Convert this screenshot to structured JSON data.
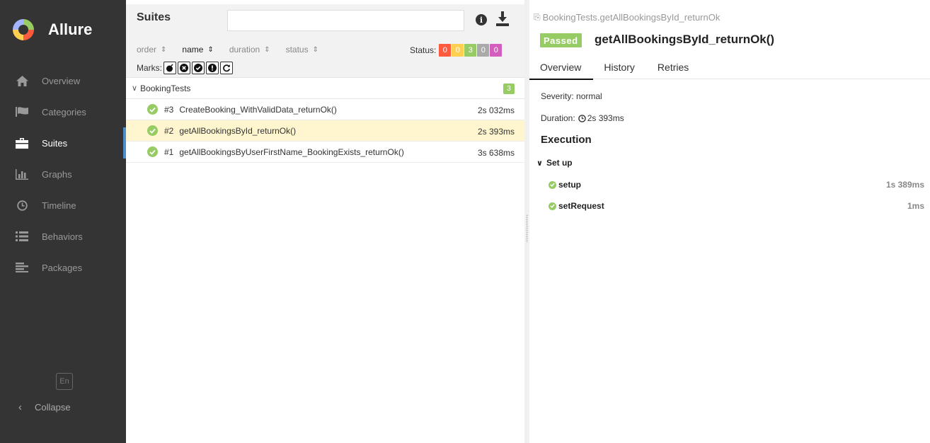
{
  "app": {
    "name": "Allure"
  },
  "sidebar": {
    "items": [
      {
        "label": "Overview",
        "icon": "home-icon"
      },
      {
        "label": "Categories",
        "icon": "flag-icon"
      },
      {
        "label": "Suites",
        "icon": "briefcase-icon",
        "active": true
      },
      {
        "label": "Graphs",
        "icon": "bar-chart-icon"
      },
      {
        "label": "Timeline",
        "icon": "clock-icon"
      },
      {
        "label": "Behaviors",
        "icon": "list-icon"
      },
      {
        "label": "Packages",
        "icon": "align-left-icon"
      }
    ],
    "language": "En",
    "collapse_label": "Collapse"
  },
  "suites": {
    "title": "Suites",
    "search_placeholder": "",
    "info_glyph": "i",
    "sort": {
      "order": "order",
      "name": "name",
      "duration": "duration",
      "status": "status",
      "caret": "⇕"
    },
    "status_label": "Status:",
    "status_counts": [
      {
        "name": "failed",
        "count": "0",
        "color": "#fd5a3e"
      },
      {
        "name": "broken",
        "count": "0",
        "color": "#ffd050"
      },
      {
        "name": "passed",
        "count": "3",
        "color": "#97cc64"
      },
      {
        "name": "skipped",
        "count": "0",
        "color": "#aaaaaa"
      },
      {
        "name": "unknown",
        "count": "0",
        "color": "#d35ebe"
      }
    ],
    "marks_label": "Marks:",
    "group": {
      "name": "BookingTests",
      "count": "3"
    },
    "tests": [
      {
        "num": "#3",
        "name": "CreateBooking_WithValidData_returnOk()",
        "duration": "2s 032ms",
        "selected": false
      },
      {
        "num": "#2",
        "name": "getAllBookingsById_returnOk()",
        "duration": "2s 393ms",
        "selected": true
      },
      {
        "num": "#1",
        "name": "getAllBookingsByUserFirstName_BookingExists_returnOk()",
        "duration": "3s 638ms",
        "selected": false
      }
    ]
  },
  "detail": {
    "breadcrumb": "BookingTests.getAllBookingsById_returnOk",
    "status_badge": "Passed",
    "title": "getAllBookingsById_returnOk()",
    "tabs": [
      "Overview",
      "History",
      "Retries"
    ],
    "severity": "Severity: normal",
    "duration_label": "Duration:",
    "duration_value": "2s 393ms",
    "execution_title": "Execution",
    "setup_title": "Set up",
    "steps": [
      {
        "name": "setup",
        "duration": "1s 389ms"
      },
      {
        "name": "setRequest",
        "duration": "1ms"
      }
    ]
  },
  "colors": {
    "sidebar_bg": "#343434",
    "passed": "#97cc64",
    "selected_row": "#fff6cf",
    "active_accent": "#4f8cc9"
  }
}
